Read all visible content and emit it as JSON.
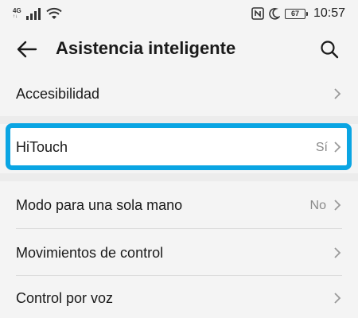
{
  "status_bar": {
    "network_type": "4G",
    "network_sub": "↑↓",
    "battery_level": "67",
    "time": "10:57",
    "icons": [
      "signal-icon",
      "wifi-icon",
      "nfc-icon",
      "moon-icon",
      "battery-icon"
    ]
  },
  "app_bar": {
    "title": "Asistencia inteligente",
    "back_icon": "back-arrow-icon",
    "search_icon": "search-icon"
  },
  "items": [
    {
      "label": "Accesibilidad",
      "value": ""
    },
    {
      "label": "HiTouch",
      "value": "Sí"
    },
    {
      "label": "Modo para una sola mano",
      "value": "No"
    },
    {
      "label": "Movimientos de control",
      "value": ""
    },
    {
      "label": "Control por voz",
      "value": ""
    }
  ],
  "colors": {
    "background": "#f4f4f4",
    "highlight_border": "#0aa5e3",
    "text": "#1a1a1a",
    "secondary_text": "#8a8a8a"
  }
}
